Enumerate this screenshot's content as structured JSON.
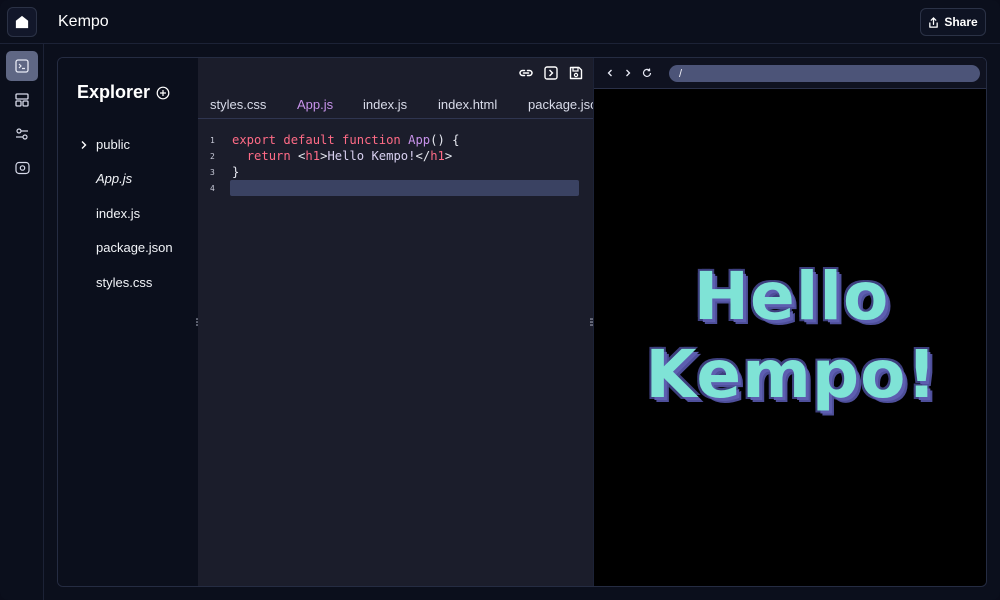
{
  "header": {
    "title": "Kempo",
    "share_label": "Share",
    "home_icon": "home-icon",
    "share_icon": "share-icon"
  },
  "rail": {
    "items": [
      {
        "icon": "terminal-icon",
        "active": true
      },
      {
        "icon": "layout-icon",
        "active": false
      },
      {
        "icon": "settings-sliders-icon",
        "active": false
      },
      {
        "icon": "preview-eye-icon",
        "active": false
      }
    ]
  },
  "explorer": {
    "title": "Explorer",
    "add_icon": "add-file-icon",
    "items": [
      {
        "label": "public",
        "type": "folder"
      },
      {
        "label": "App.js",
        "type": "file",
        "active": true
      },
      {
        "label": "index.js",
        "type": "file"
      },
      {
        "label": "package.json",
        "type": "file"
      },
      {
        "label": "styles.css",
        "type": "file"
      }
    ]
  },
  "editor": {
    "toolbar_icons": [
      "link-icon",
      "run-icon",
      "save-icon"
    ],
    "tabs": [
      {
        "label": "styles.css",
        "active": false
      },
      {
        "label": "App.js",
        "active": true
      },
      {
        "label": "index.js",
        "active": false
      },
      {
        "label": "index.html",
        "active": false
      },
      {
        "label": "package.json",
        "active": false
      }
    ],
    "lines": [
      {
        "number": "1",
        "text": "export default function App() {"
      },
      {
        "number": "2",
        "text": "  return <h1>Hello Kempo!</h1>"
      },
      {
        "number": "3",
        "text": "}"
      },
      {
        "number": "4",
        "text": ""
      }
    ]
  },
  "preview": {
    "nav_icons": [
      "back-icon",
      "forward-icon",
      "refresh-icon"
    ],
    "url": "/",
    "heading_line1": "Hello",
    "heading_line2": "Kempo!"
  },
  "colors": {
    "background": "#0b0f1c",
    "editor_bg": "#1b1d2b",
    "accent_purple": "#c792ea",
    "keyword_pink": "#ff6b86",
    "heading_teal": "#7fe3d6",
    "heading_shadow": "#5d5eb0"
  }
}
